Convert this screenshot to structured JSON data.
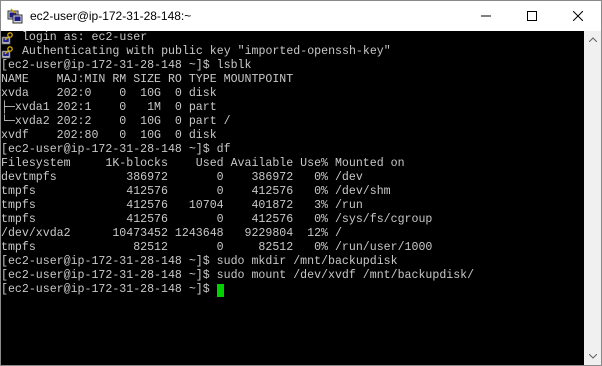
{
  "window": {
    "title": "ec2-user@ip-172-31-28-148:~"
  },
  "terminal": {
    "lines": [
      {
        "icon": "putty-key-icon",
        "text": " login as: ec2-user"
      },
      {
        "icon": "putty-key-icon",
        "text": " Authenticating with public key \"imported-openssh-key\""
      },
      {
        "text": "[ec2-user@ip-172-31-28-148 ~]$ lsblk"
      },
      {
        "text": "NAME    MAJ:MIN RM SIZE RO TYPE MOUNTPOINT"
      },
      {
        "text": "xvda    202:0    0  10G  0 disk"
      },
      {
        "text": "├─xvda1 202:1    0   1M  0 part"
      },
      {
        "text": "└─xvda2 202:2    0  10G  0 part /"
      },
      {
        "text": "xvdf    202:80   0  10G  0 disk"
      },
      {
        "text": "[ec2-user@ip-172-31-28-148 ~]$ df"
      },
      {
        "text": "Filesystem     1K-blocks    Used Available Use% Mounted on"
      },
      {
        "text": "devtmpfs          386972       0    386972   0% /dev"
      },
      {
        "text": "tmpfs             412576       0    412576   0% /dev/shm"
      },
      {
        "text": "tmpfs             412576   10704    401872   3% /run"
      },
      {
        "text": "tmpfs             412576       0    412576   0% /sys/fs/cgroup"
      },
      {
        "text": "/dev/xvda2      10473452 1243648   9229804  12% /"
      },
      {
        "text": "tmpfs              82512       0     82512   0% /run/user/1000"
      },
      {
        "text": "[ec2-user@ip-172-31-28-148 ~]$ sudo mkdir /mnt/backupdisk"
      },
      {
        "text": "[ec2-user@ip-172-31-28-148 ~]$ sudo mount /dev/xvdf /mnt/backupdisk/"
      },
      {
        "text": "[ec2-user@ip-172-31-28-148 ~]$ ",
        "cursor": true
      }
    ]
  },
  "colors": {
    "background": "#000000",
    "text": "#c8c8c8",
    "cursor": "#00d000",
    "titlebar": "#ffffff"
  }
}
